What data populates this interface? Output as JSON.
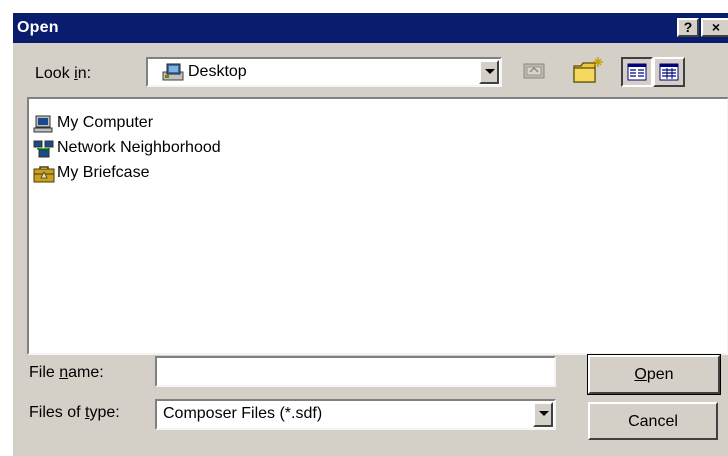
{
  "window": {
    "title": "Open",
    "help_glyph": "?",
    "close_glyph": "×"
  },
  "look_in": {
    "label_pre": "Look ",
    "label_accel": "i",
    "label_post": "n:",
    "value": "Desktop",
    "icon": "desktop-icon"
  },
  "toolbar": {
    "buttons": [
      "up-one-level-icon",
      "create-new-folder-icon",
      "list-view-icon",
      "details-view-icon"
    ]
  },
  "files": [
    {
      "name": "My Computer",
      "icon": "my-computer-icon"
    },
    {
      "name": "Network Neighborhood",
      "icon": "network-neighborhood-icon"
    },
    {
      "name": "My Briefcase",
      "icon": "briefcase-icon"
    }
  ],
  "file_name": {
    "label_pre": "File ",
    "label_accel": "n",
    "label_post": "ame:",
    "value": ""
  },
  "file_type": {
    "label_pre": "Files of ",
    "label_accel": "t",
    "label_post": "ype:",
    "value": "Composer Files (*.sdf)"
  },
  "buttons": {
    "open_accel": "O",
    "open_rest": "pen",
    "cancel": "Cancel"
  },
  "colors": {
    "titlebar": "#0a1c6e",
    "face": "#d4d0c8"
  }
}
